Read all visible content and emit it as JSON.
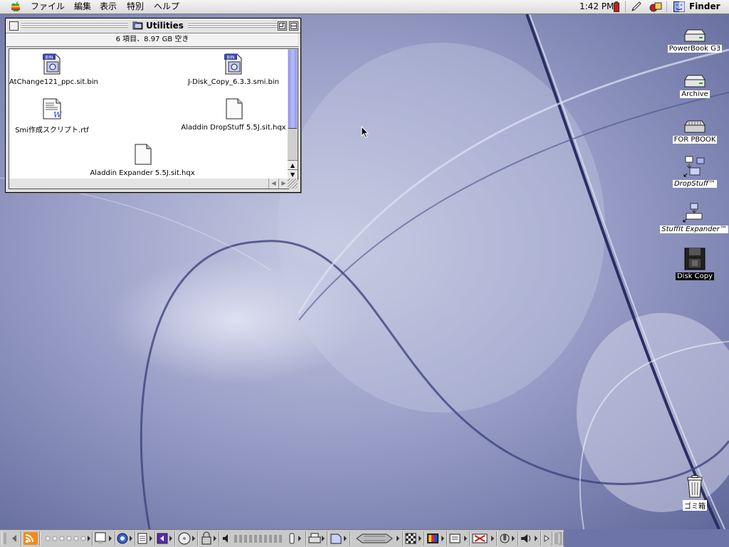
{
  "menubar": {
    "apple_icon": "apple-logo-icon",
    "menus": [
      "ファイル",
      "編集",
      "表示",
      "特別",
      "ヘルプ"
    ],
    "clock": "1:42 PM",
    "app_name": "Finder"
  },
  "window": {
    "title": "Utilities",
    "info": "6 項目、8.97 GB 空き",
    "files": [
      {
        "name": "AtChange121_ppc.sit.bin",
        "icon": "bin-archive-icon"
      },
      {
        "name": "J-Disk_Copy_6.3.3.smi.bin",
        "icon": "bin-archive-icon"
      },
      {
        "name": "Smi作成スクリプト.rtf",
        "icon": "rtf-document-icon"
      },
      {
        "name": "Aladdin DropStuff 5.5J.sit.hqx",
        "icon": "generic-document-icon"
      },
      {
        "name": "Aladdin Expander 5.5J.sit.hqx",
        "icon": "generic-document-icon"
      }
    ]
  },
  "desktop_icons": [
    {
      "label": "PowerBook G3",
      "icon": "hard-disk-icon"
    },
    {
      "label": "Archive",
      "icon": "hard-disk-icon"
    },
    {
      "label": "FOR PBOOK",
      "icon": "network-volume-icon"
    },
    {
      "label": "DropStuff™",
      "icon": "dropstuff-alias-icon"
    },
    {
      "label": "StuffIt Expander™",
      "icon": "stuffit-expander-alias-icon"
    },
    {
      "label": "Disk Copy",
      "icon": "disk-copy-icon"
    },
    {
      "label": "ゴミ箱",
      "icon": "trash-icon"
    }
  ],
  "colors": {
    "wallpaper": "#6d74a8",
    "scroll_thumb": "#9aa0f4",
    "battery": "#d01818"
  }
}
